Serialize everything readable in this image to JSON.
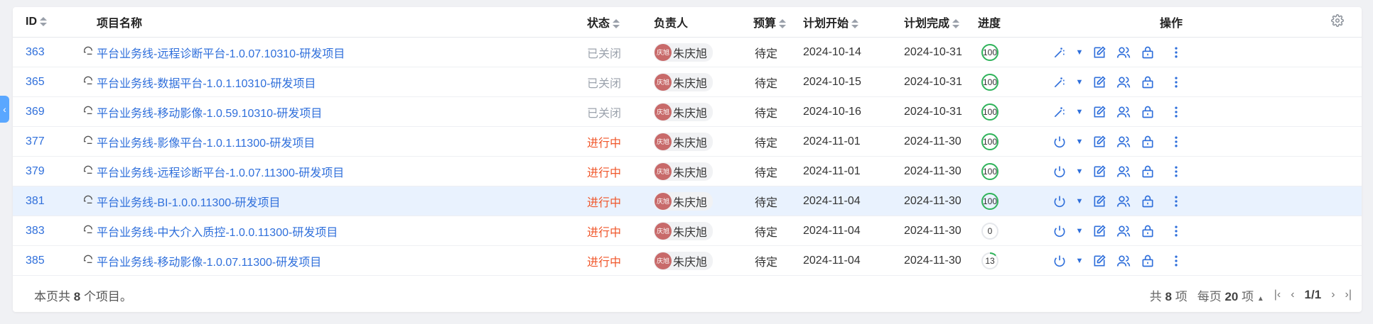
{
  "columns": {
    "id": "ID",
    "name": "项目名称",
    "status": "状态",
    "owner": "负责人",
    "budget": "预算",
    "begin": "计划开始",
    "end": "计划完成",
    "progress": "进度",
    "actions": "操作"
  },
  "rows": [
    {
      "id": "363",
      "name": "平台业务线-远程诊断平台-1.0.07.10310-研发项目",
      "status": "已关闭",
      "status_kind": "closed",
      "owner_avatar": "庆旭",
      "owner": "朱庆旭",
      "budget": "待定",
      "begin": "2024-10-14",
      "end": "2024-10-31",
      "progress": "100",
      "progress_value": 100,
      "action_icon": "magic-wand-icon"
    },
    {
      "id": "365",
      "name": "平台业务线-数据平台-1.0.1.10310-研发项目",
      "status": "已关闭",
      "status_kind": "closed",
      "owner_avatar": "庆旭",
      "owner": "朱庆旭",
      "budget": "待定",
      "begin": "2024-10-15",
      "end": "2024-10-31",
      "progress": "100",
      "progress_value": 100,
      "action_icon": "magic-wand-icon"
    },
    {
      "id": "369",
      "name": "平台业务线-移动影像-1.0.59.10310-研发项目",
      "status": "已关闭",
      "status_kind": "closed",
      "owner_avatar": "庆旭",
      "owner": "朱庆旭",
      "budget": "待定",
      "begin": "2024-10-16",
      "end": "2024-10-31",
      "progress": "100",
      "progress_value": 100,
      "action_icon": "magic-wand-icon"
    },
    {
      "id": "377",
      "name": "平台业务线-影像平台-1.0.1.11300-研发项目",
      "status": "进行中",
      "status_kind": "active",
      "owner_avatar": "庆旭",
      "owner": "朱庆旭",
      "budget": "待定",
      "begin": "2024-11-01",
      "end": "2024-11-30",
      "progress": "100",
      "progress_value": 100,
      "action_icon": "power-icon"
    },
    {
      "id": "379",
      "name": "平台业务线-远程诊断平台-1.0.07.11300-研发项目",
      "status": "进行中",
      "status_kind": "active",
      "owner_avatar": "庆旭",
      "owner": "朱庆旭",
      "budget": "待定",
      "begin": "2024-11-01",
      "end": "2024-11-30",
      "progress": "100",
      "progress_value": 100,
      "action_icon": "power-icon"
    },
    {
      "id": "381",
      "name": "平台业务线-BI-1.0.0.11300-研发项目",
      "status": "进行中",
      "status_kind": "active",
      "owner_avatar": "庆旭",
      "owner": "朱庆旭",
      "budget": "待定",
      "begin": "2024-11-04",
      "end": "2024-11-30",
      "progress": "100",
      "progress_value": 100,
      "action_icon": "power-icon",
      "highlight": true
    },
    {
      "id": "383",
      "name": "平台业务线-中大介入质控-1.0.0.11300-研发项目",
      "status": "进行中",
      "status_kind": "active",
      "owner_avatar": "庆旭",
      "owner": "朱庆旭",
      "budget": "待定",
      "begin": "2024-11-04",
      "end": "2024-11-30",
      "progress": "0",
      "progress_value": 0,
      "action_icon": "power-icon"
    },
    {
      "id": "385",
      "name": "平台业务线-移动影像-1.0.07.11300-研发项目",
      "status": "进行中",
      "status_kind": "active",
      "owner_avatar": "庆旭",
      "owner": "朱庆旭",
      "budget": "待定",
      "begin": "2024-11-04",
      "end": "2024-11-30",
      "progress": "13",
      "progress_value": 13,
      "action_icon": "power-icon"
    }
  ],
  "footer": {
    "summary_prefix": "本页共",
    "summary_count": "8",
    "summary_suffix": "个项目。",
    "total_prefix": "共",
    "total_count": "8",
    "total_suffix": "项",
    "per_page_prefix": "每页",
    "per_page_count": "20",
    "per_page_suffix": "项",
    "page": "1/1"
  },
  "colors": {
    "link": "#2f6fdb",
    "closed": "#9ca3ad",
    "active": "#f0562a",
    "progress": "#2fb45a",
    "icon": "#2f6fdb",
    "highlight_row": "#e9f2fe"
  }
}
